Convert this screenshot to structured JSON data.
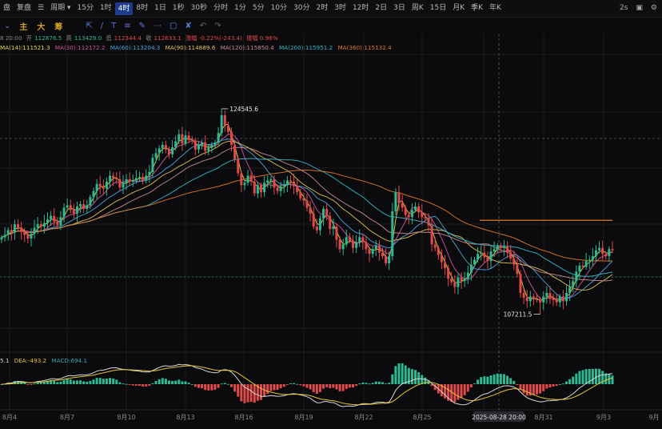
{
  "toolbar": {
    "items": [
      "盘",
      "复盘",
      "",
      "周期",
      "15分",
      "1时",
      "4时",
      "8时",
      "1日",
      "1秒",
      "30秒",
      "分时",
      "1分",
      "5分",
      "10分",
      "30分",
      "2时",
      "3时",
      "12时",
      "2日",
      "3日",
      "周K",
      "15日",
      "月K",
      "季K",
      "年K"
    ],
    "active_index": 6,
    "right": [
      "2s"
    ]
  },
  "tools": {
    "labels": [
      "主",
      "大",
      "筹"
    ]
  },
  "ohlc": {
    "time": "8 20:00",
    "open_label": "开",
    "open": "112876.5",
    "high_label": "高",
    "high": "113429.0",
    "low_label": "低",
    "low": "112344.4",
    "close_label": "收",
    "close": "112633.1",
    "change": "涨幅 -0.22%(-243.4)",
    "amplitude": "振幅 0.96%"
  },
  "ma_legend": [
    {
      "text": "MA(14):111521.3",
      "color": "#e8d84a"
    },
    {
      "text": "MA(30):112172.2",
      "color": "#d4559c"
    },
    {
      "text": "MA(60):113204.3",
      "color": "#4fa3d8"
    },
    {
      "text": "MA(90):114889.6",
      "color": "#e2c25c"
    },
    {
      "text": "MA(120):115850.4",
      "color": "#c98b94"
    },
    {
      "text": "MA(200):115951.2",
      "color": "#39b8c8"
    },
    {
      "text": "MA(360):115132.4",
      "color": "#e07a2e"
    }
  ],
  "macd_legend": [
    {
      "text": "5.1",
      "color": "#d8d8d8"
    },
    {
      "text": "DEA:-493.2",
      "color": "#e8c23a"
    },
    {
      "text": "MACD:694.1",
      "color": "#3aa6b6"
    }
  ],
  "colors": {
    "up": "#2fb892",
    "down": "#e04a4a",
    "grid": "#1b1b1f",
    "crosshair": "#555"
  },
  "chart_data": {
    "type": "candlestick",
    "ylim": [
      104000,
      129000
    ],
    "annotations": [
      {
        "label": "124545.6",
        "value": 124545.6,
        "kind": "high"
      },
      {
        "label": "107211.5",
        "value": 107211.5,
        "kind": "low"
      }
    ],
    "x_ticks": [
      "8月4",
      "8月7",
      "8月10",
      "8月13",
      "8月16",
      "8月19",
      "8月22",
      "8月25",
      "8月28",
      "8月31",
      "9月3",
      "9月"
    ],
    "crosshair_label": "2025-08-28 20:00",
    "closes": [
      113700,
      113900,
      114300,
      114100,
      114800,
      114500,
      114200,
      113900,
      113600,
      114000,
      114500,
      114800,
      114600,
      114900,
      115200,
      115500,
      115000,
      114700,
      115400,
      116200,
      116400,
      116000,
      115700,
      116300,
      116500,
      116100,
      116400,
      117100,
      117600,
      118200,
      118000,
      117800,
      118400,
      118900,
      118700,
      118600,
      117900,
      118300,
      118600,
      118400,
      118500,
      118700,
      118800,
      118500,
      118900,
      119200,
      120400,
      120800,
      121200,
      121500,
      121100,
      120700,
      121300,
      121800,
      122400,
      121600,
      122300,
      121900,
      121800,
      121100,
      121500,
      121700,
      121000,
      121300,
      121500,
      121700,
      122500,
      124000,
      123100,
      122600,
      121500,
      120300,
      119100,
      118100,
      118300,
      118900,
      118400,
      117400,
      118100,
      117500,
      118300,
      118500,
      118600,
      117900,
      117600,
      118000,
      118100,
      118500,
      118400,
      118000,
      117500,
      117000,
      116800,
      116200,
      115700,
      114600,
      114300,
      115300,
      116100,
      115500,
      114400,
      114600,
      113500,
      112700,
      113100,
      113700,
      113400,
      112800,
      113300,
      113700,
      113300,
      112700,
      112300,
      112700,
      113000,
      112400,
      112100,
      111500,
      112100,
      115900,
      117500,
      116600,
      116200,
      115600,
      115400,
      116000,
      116300,
      115800,
      115400,
      115300,
      114700,
      113100,
      112800,
      112200,
      111600,
      111100,
      110200,
      109900,
      109500,
      110300,
      110000,
      110200,
      110700,
      111400,
      111800,
      112300,
      112400,
      112000,
      111700,
      112500,
      112700,
      113000,
      112800,
      112900,
      112400,
      111900,
      111400,
      110600,
      109000,
      108600,
      108300,
      108700,
      108500,
      108400,
      108200,
      108700,
      109000,
      108500,
      108400,
      108200,
      108700,
      108300,
      109000,
      109500,
      110000,
      110800,
      111300,
      111200,
      111700,
      111800,
      112100,
      112600,
      112800,
      112300,
      112100,
      112700,
      112600
    ],
    "ma_series": [
      "MA(14)",
      "MA(30)",
      "MA(60)",
      "MA(90)",
      "MA(120)",
      "MA(200)",
      "MA(360)"
    ]
  }
}
